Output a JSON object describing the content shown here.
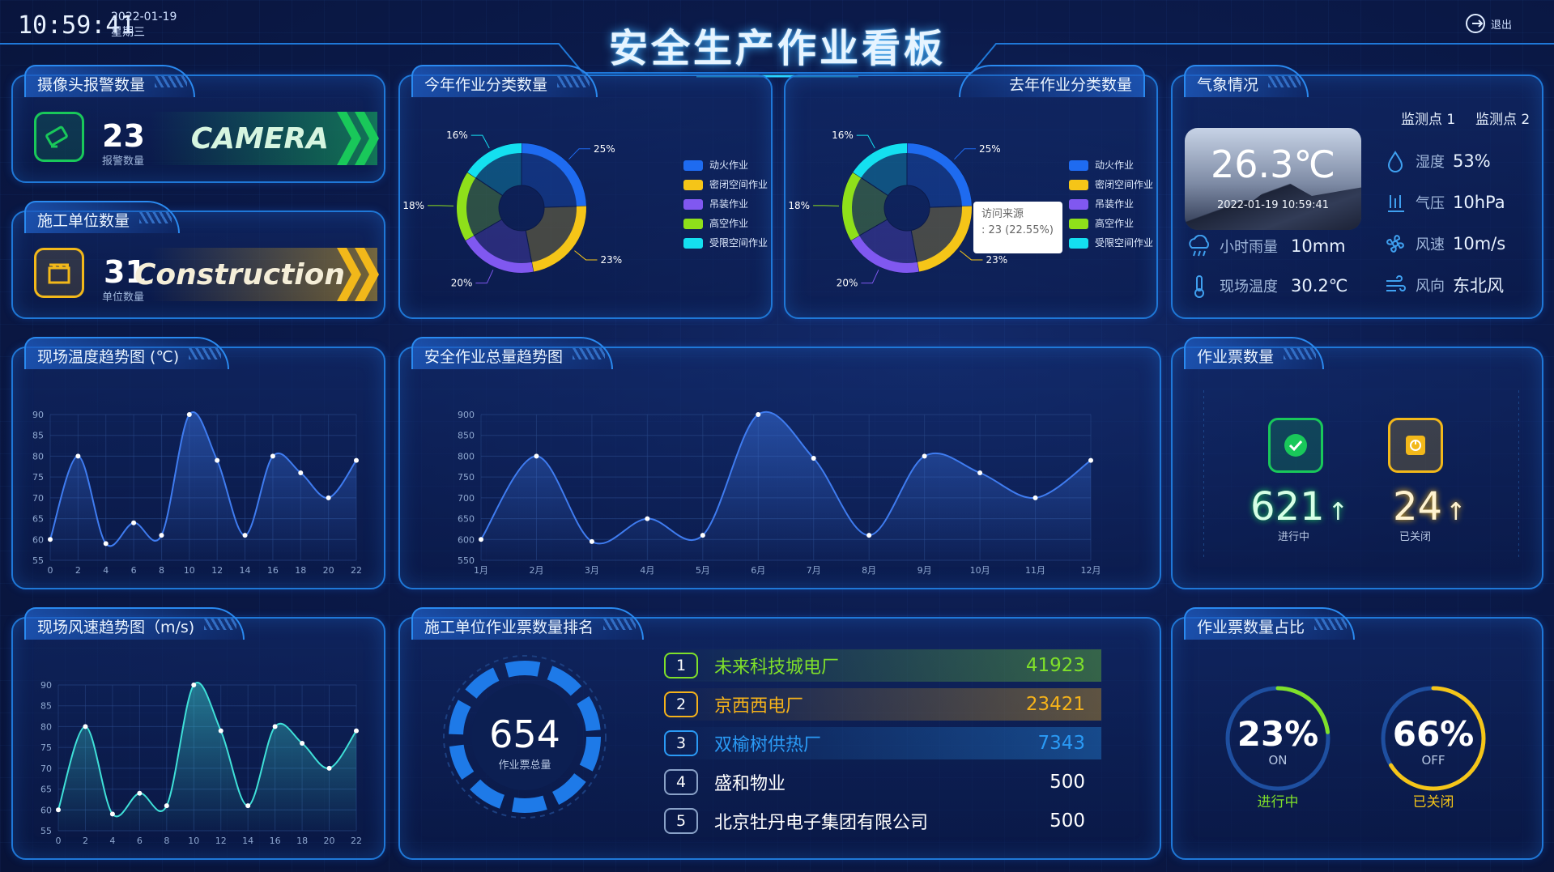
{
  "header": {
    "clock": "10:59:41",
    "date": "2022-01-19",
    "weekday": "星期三",
    "title": "安全生产作业看板",
    "logout_label": "退出"
  },
  "camera_panel": {
    "title": "摄像头报警数量",
    "value": "23",
    "sub": "报警数量",
    "band_text": "CAMERA",
    "color": "#19c85a"
  },
  "construction_panel": {
    "title": "施工单位数量",
    "value": "31",
    "sub": "单位数量",
    "band_text": "Construction",
    "color": "#f2b81a"
  },
  "pie_legend": [
    "动火作业",
    "密闭空间作业",
    "吊装作业",
    "高空作业",
    "受限空间作业"
  ],
  "pie_colors": [
    "#1e6bf0",
    "#f5c518",
    "#8058f0",
    "#8fe01a",
    "#14e0f0"
  ],
  "pie_this_year": {
    "title": "今年作业分类数量",
    "labels": [
      "25%",
      "23%",
      "20%",
      "18%",
      "16%"
    ]
  },
  "pie_last_year": {
    "title": "去年作业分类数量",
    "labels": [
      "25%",
      "23%",
      "20%",
      "18%",
      "16%"
    ],
    "tooltip_title": "访问来源",
    "tooltip_value": ": 23 (22.55%)"
  },
  "weather": {
    "title": "气象情况",
    "tab1": "监测点 1",
    "tab2": "监测点 2",
    "temp": "26.3℃",
    "time": "2022-01-19 10:59:41",
    "rain_label": "小时雨量",
    "rain_value": "10mm",
    "site_temp_label": "现场温度",
    "site_temp_value": "30.2℃",
    "humidity_label": "湿度",
    "humidity_value": "53%",
    "pressure_label": "气压",
    "pressure_value": "10hPa",
    "wind_speed_label": "风速",
    "wind_speed_value": "10m/s",
    "wind_dir_label": "风向",
    "wind_dir_value": "东北风"
  },
  "temp_chart_title": "现场温度趋势图 (℃)",
  "total_chart_title": "安全作业总量趋势图",
  "wind_chart_title": "现场风速趋势图（m/s)",
  "tickets": {
    "title": "作业票数量",
    "active_value": "621",
    "active_label": "进行中",
    "closed_value": "24",
    "closed_label": "已关闭",
    "arrow": "↑"
  },
  "ranking": {
    "title": "施工单位作业票数量排名",
    "total_value": "654",
    "total_label": "作业票总量",
    "rows": [
      {
        "rank": "1",
        "name": "未来科技城电厂",
        "value": "41923"
      },
      {
        "rank": "2",
        "name": "京西西电厂",
        "value": "23421"
      },
      {
        "rank": "3",
        "name": "双榆树供热厂",
        "value": "7343"
      },
      {
        "rank": "4",
        "name": "盛和物业",
        "value": "500"
      },
      {
        "rank": "5",
        "name": "北京牡丹电子集团有限公司",
        "value": "500"
      }
    ],
    "colors": [
      "#7fe02a",
      "#f5b21a",
      "#2a9af5",
      "#ffffff",
      "#ffffff"
    ]
  },
  "ratio": {
    "title": "作业票数量占比",
    "on_pct": "23%",
    "on_sub": "ON",
    "on_cap": "进行中",
    "on_fraction": 0.23,
    "off_pct": "66%",
    "off_sub": "OFF",
    "off_cap": "已关闭",
    "off_fraction": 0.66
  },
  "chart_data": [
    {
      "type": "pie",
      "title": "今年作业分类数量",
      "categories": [
        "动火作业",
        "密闭空间作业",
        "吊装作业",
        "高空作业",
        "受限空间作业"
      ],
      "values": [
        25,
        23,
        20,
        18,
        16
      ],
      "legend": "right"
    },
    {
      "type": "pie",
      "title": "去年作业分类数量",
      "categories": [
        "动火作业",
        "密闭空间作业",
        "吊装作业",
        "高空作业",
        "受限空间作业"
      ],
      "values": [
        25,
        23,
        20,
        18,
        16
      ],
      "legend": "right"
    },
    {
      "type": "area",
      "title": "现场温度趋势图 (℃)",
      "x": [
        0,
        2,
        4,
        6,
        8,
        10,
        12,
        14,
        16,
        18,
        20,
        22
      ],
      "values": [
        60,
        80,
        59,
        64,
        61,
        90,
        79,
        61,
        80,
        76,
        70,
        79
      ],
      "xticks": [
        0,
        2,
        4,
        6,
        8,
        10,
        12,
        14,
        16,
        18,
        20,
        22
      ],
      "yticks": [
        55,
        60,
        65,
        70,
        75,
        80,
        85,
        90
      ],
      "ylim": [
        55,
        90
      ],
      "grid": true,
      "color": "#3f7cf0"
    },
    {
      "type": "area",
      "title": "安全作业总量趋势图",
      "categories": [
        "1月",
        "2月",
        "3月",
        "4月",
        "5月",
        "6月",
        "7月",
        "8月",
        "9月",
        "10月",
        "11月",
        "12月"
      ],
      "values": [
        600,
        800,
        595,
        650,
        610,
        900,
        795,
        610,
        800,
        760,
        700,
        790
      ],
      "yticks": [
        550,
        600,
        650,
        700,
        750,
        800,
        850,
        900
      ],
      "ylim": [
        550,
        900
      ],
      "grid": true,
      "color": "#3f7cf0"
    },
    {
      "type": "area",
      "title": "现场风速趋势图（m/s)",
      "x": [
        0,
        2,
        4,
        6,
        8,
        10,
        12,
        14,
        16,
        18,
        20,
        22
      ],
      "values": [
        60,
        80,
        59,
        64,
        61,
        90,
        79,
        61,
        80,
        76,
        70,
        79
      ],
      "xticks": [
        0,
        2,
        4,
        6,
        8,
        10,
        12,
        14,
        16,
        18,
        20,
        22
      ],
      "yticks": [
        55,
        60,
        65,
        70,
        75,
        80,
        85,
        90
      ],
      "ylim": [
        55,
        90
      ],
      "grid": true,
      "color": "#3fe0d8"
    }
  ]
}
